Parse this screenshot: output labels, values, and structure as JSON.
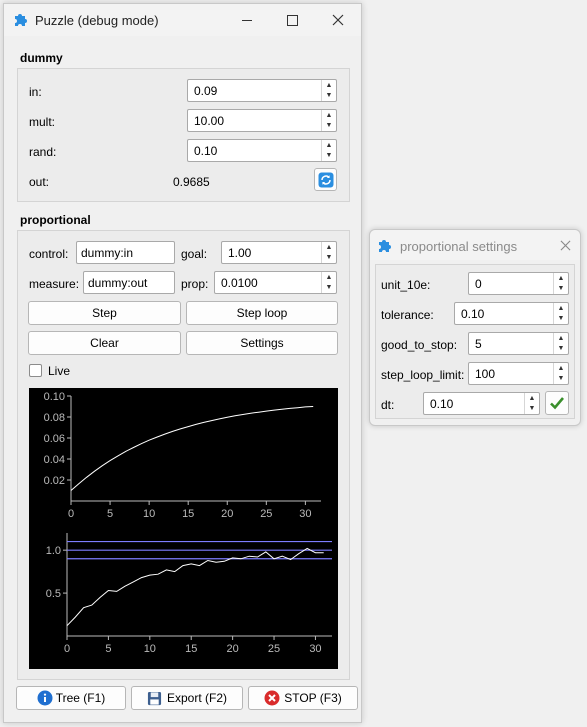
{
  "window": {
    "title": "Puzzle (debug mode)"
  },
  "dummy": {
    "title": "dummy",
    "in_label": "in:",
    "in_value": "0.09",
    "mult_label": "mult:",
    "mult_value": "10.00",
    "rand_label": "rand:",
    "rand_value": "0.10",
    "out_label": "out:",
    "out_value": "0.9685"
  },
  "proportional": {
    "title": "proportional",
    "control_label": "control:",
    "control_value": "dummy:in",
    "goal_label": "goal:",
    "goal_value": "1.00",
    "measure_label": "measure:",
    "measure_value": "dummy:out",
    "prop_label": "prop:",
    "prop_value": "0.0100",
    "step_label": "Step",
    "step_loop_label": "Step loop",
    "clear_label": "Clear",
    "settings_label": "Settings",
    "live_label": "Live",
    "live_checked": false
  },
  "footer": {
    "tree_label": "Tree (F1)",
    "export_label": "Export (F2)",
    "stop_label": "STOP (F3)"
  },
  "settings_window": {
    "title": "proportional settings",
    "unit_10e_label": "unit_10e:",
    "unit_10e_value": "0",
    "tolerance_label": "tolerance:",
    "tolerance_value": "0.10",
    "good_to_stop_label": "good_to_stop:",
    "good_to_stop_value": "5",
    "step_loop_limit_label": "step_loop_limit:",
    "step_loop_limit_value": "100",
    "dt_label": "dt:",
    "dt_value": "0.10"
  },
  "colors": {
    "plot_background": "#000000",
    "plot_axis": "#bbbbbb",
    "plot_line": "#ffffff",
    "tolerance_band": "#7d7dff",
    "stop_icon": "#d92b2b",
    "info_icon": "#1f6fd0",
    "accent_blue": "#2a8ee0",
    "ok_check": "#3a8f2c"
  },
  "icons": {
    "window_icon": "puzzle-icon",
    "refresh": "refresh-icon",
    "tree": "info-icon",
    "export": "save-icon",
    "stop": "stop-icon",
    "apply": "checkmark-icon"
  },
  "chart_data": [
    {
      "type": "line",
      "xlim": [
        0,
        32
      ],
      "ylim": [
        0,
        0.1
      ],
      "x_ticks": [
        "0",
        "5",
        "10",
        "15",
        "20",
        "25",
        "30"
      ],
      "y_ticks": [
        "0.02",
        "0.04",
        "0.06",
        "0.08",
        "0.10"
      ],
      "grid": false,
      "series": [
        {
          "x": [
            0,
            1,
            2,
            3,
            4,
            5,
            6,
            7,
            8,
            9,
            10,
            11,
            12,
            13,
            14,
            15,
            16,
            17,
            18,
            19,
            20,
            21,
            22,
            23,
            24,
            25,
            26,
            27,
            28,
            29,
            30,
            31
          ],
          "y": [
            0.01,
            0.0165,
            0.0226,
            0.0283,
            0.0336,
            0.0385,
            0.043,
            0.0472,
            0.051,
            0.0546,
            0.0579,
            0.0609,
            0.0637,
            0.0663,
            0.0687,
            0.0709,
            0.073,
            0.0749,
            0.0766,
            0.0782,
            0.0797,
            0.0811,
            0.0824,
            0.0836,
            0.0846,
            0.0856,
            0.0866,
            0.0874,
            0.0882,
            0.0889,
            0.0896,
            0.09
          ]
        }
      ]
    },
    {
      "type": "line",
      "xlim": [
        0,
        32
      ],
      "ylim": [
        0,
        1.2
      ],
      "x_ticks": [
        "0",
        "5",
        "10",
        "15",
        "20",
        "25",
        "30"
      ],
      "y_ticks": [
        "0.5",
        "1.0"
      ],
      "grid": false,
      "reference_lines": [
        0.9,
        1.0,
        1.1
      ],
      "series": [
        {
          "x": [
            0,
            1,
            2,
            3,
            4,
            5,
            6,
            7,
            8,
            9,
            10,
            11,
            12,
            13,
            14,
            15,
            16,
            17,
            18,
            19,
            20,
            21,
            22,
            23,
            24,
            25,
            26,
            27,
            28,
            29,
            30,
            31
          ],
          "y": [
            0.12,
            0.22,
            0.33,
            0.36,
            0.45,
            0.53,
            0.52,
            0.58,
            0.63,
            0.68,
            0.71,
            0.72,
            0.77,
            0.75,
            0.82,
            0.84,
            0.82,
            0.88,
            0.86,
            0.87,
            0.91,
            0.9,
            0.93,
            0.92,
            0.98,
            0.9,
            0.93,
            0.89,
            0.96,
            1.02,
            0.97,
            0.97
          ]
        }
      ]
    }
  ]
}
